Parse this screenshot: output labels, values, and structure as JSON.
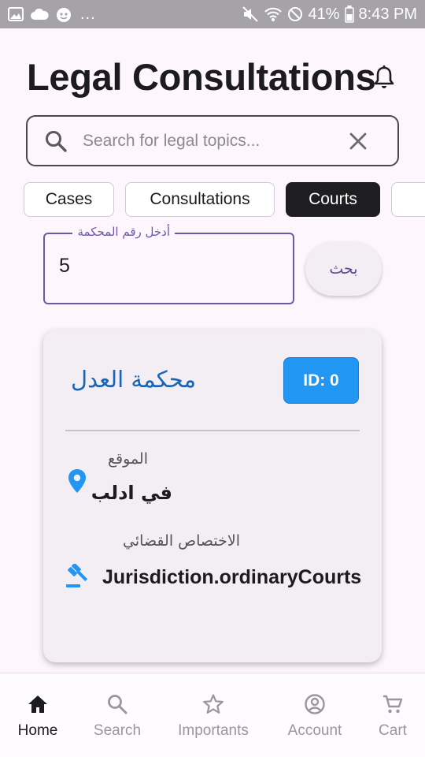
{
  "status_bar": {
    "battery_percent": "41%",
    "time": "8:43 PM",
    "left_icons": [
      "image-icon",
      "cloud-icon",
      "android-icon"
    ],
    "more": "...",
    "right_icons": [
      "mute-icon",
      "wifi-icon",
      "do-not-disturb-icon",
      "battery-icon"
    ]
  },
  "header": {
    "title": "Legal Consultations",
    "notification_icon": "bell-icon"
  },
  "search": {
    "placeholder": "Search for legal topics...",
    "value": ""
  },
  "filters": {
    "chips": [
      {
        "label": "Cases",
        "selected": false
      },
      {
        "label": "Consultations",
        "selected": false
      },
      {
        "label": "Courts",
        "selected": true
      },
      {
        "label": "",
        "selected": false
      }
    ]
  },
  "court_lookup": {
    "field_label": "أدخل رقم المحكمة",
    "field_value": "5",
    "button_label": "بحث"
  },
  "court_card": {
    "name": "محكمة العدل",
    "id_badge": "ID: 0",
    "location_label": "الموقع",
    "location_value": "في ادلب",
    "jurisdiction_label": "الاختصاص القضائي",
    "jurisdiction_value": "Jurisdiction.ordinaryCourts"
  },
  "bottom_nav": {
    "items": [
      {
        "label": "Home",
        "icon": "home-icon",
        "active": true
      },
      {
        "label": "Search",
        "icon": "search-icon",
        "active": false
      },
      {
        "label": "Importants",
        "icon": "star-icon",
        "active": false
      },
      {
        "label": "Account",
        "icon": "account-icon",
        "active": false
      },
      {
        "label": "Cart",
        "icon": "cart-icon",
        "active": false
      }
    ]
  },
  "colors": {
    "background": "#fdf6fc",
    "accent_purple": "#6f57a6",
    "accent_blue": "#2196f3",
    "court_name_blue": "#1a65b3",
    "selected_chip": "#1e1d1f"
  }
}
